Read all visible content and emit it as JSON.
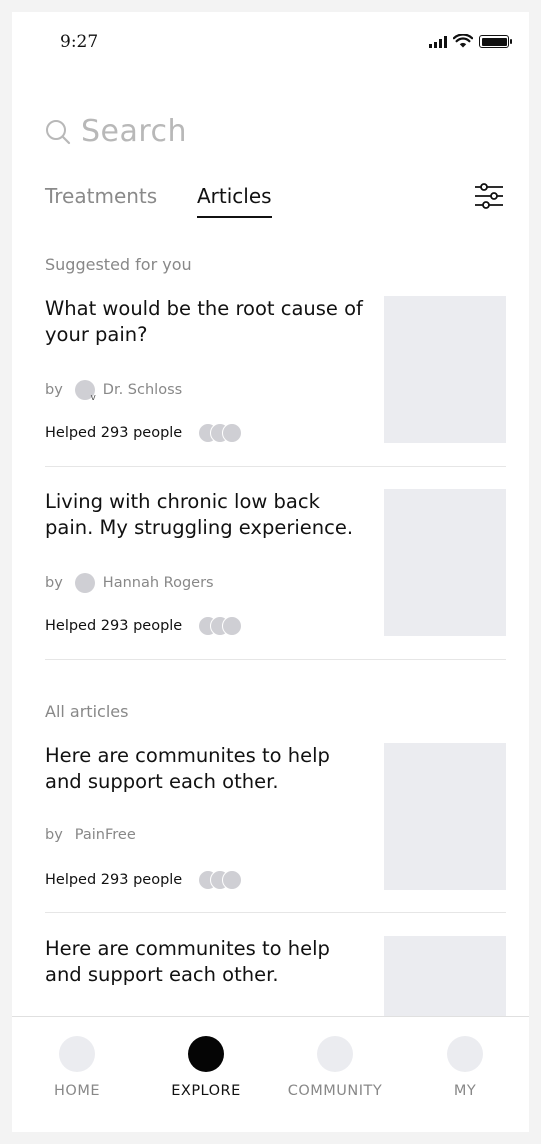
{
  "status_bar": {
    "time": "9:27",
    "battery_level": 1.0
  },
  "search": {
    "placeholder": "Search",
    "icon": "search-icon"
  },
  "tabs": [
    {
      "label": "Treatments",
      "active": false
    },
    {
      "label": "Articles",
      "active": true
    }
  ],
  "filter": {
    "icon": "sliders-icon"
  },
  "suggested": {
    "title": "Suggested for you",
    "articles": [
      {
        "title": "What would be the root cause of your pain?",
        "by": "by",
        "author": "Dr. Schloss",
        "author_verified": true,
        "helped": "Helped 293 people"
      },
      {
        "title": "Living with chronic low back pain. My struggling experience.",
        "by": "by",
        "author": "Hannah Rogers",
        "author_verified": false,
        "helped": "Helped 293 people"
      }
    ]
  },
  "all_articles": {
    "title": "All articles",
    "articles": [
      {
        "title": "Here are communites to help and support each other.",
        "by": "by",
        "author": "PainFree",
        "helped": "Helped 293 people"
      },
      {
        "title": "Here are communites to help and support each other."
      }
    ]
  },
  "bottom_nav": [
    {
      "label": "HOME",
      "active": false
    },
    {
      "label": "EXPLORE",
      "active": true
    },
    {
      "label": "COMMUNITY",
      "active": false
    },
    {
      "label": "MY",
      "active": false
    }
  ],
  "colors": {
    "thumbnail": "#ebecf0",
    "muted_text": "#888888",
    "active": "#050505"
  }
}
